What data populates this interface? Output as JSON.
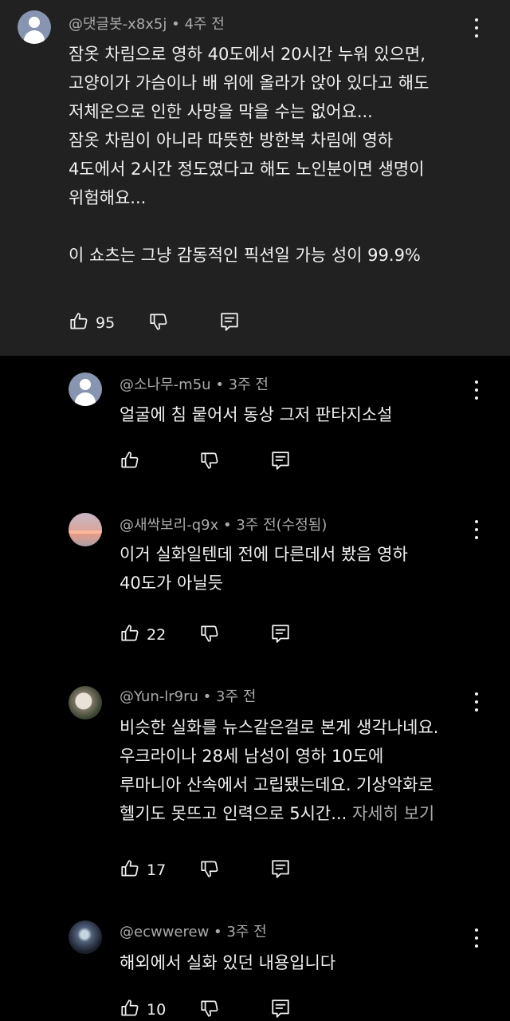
{
  "comments": [
    {
      "author": "@댓글봇-x8x5j",
      "time": "4주 전",
      "avatar": "default-avatar-icon",
      "lines": [
        "잠옷 차림으로 영하 40도에서 20시간 누워 있으면,",
        "고양이가 가슴이나 배 위에 올라가 앉아 있다고 해도",
        "저체온으로 인한 사망을 막을 수는 없어요...",
        "잠옷 차림이 아니라 따뜻한 방한복 차림에 영하",
        "4도에서 2시간 정도였다고 해도 노인분이면 생명이",
        "위험해요...",
        "",
        "이 쇼츠는 그냥 감동적인 픽션일 가능 성이 99.9%"
      ],
      "likes": "95"
    },
    {
      "author": "@소나무-m5u",
      "time": "3주 전",
      "avatar": "default-avatar-icon",
      "lines": [
        "얼굴에 침 뭍어서 동상 그저 판타지소설"
      ],
      "likes": ""
    },
    {
      "author": "@새싹보리-q9x",
      "time": "3주 전(수정됨)",
      "avatar": "sunset-photo-avatar",
      "lines": [
        "이거 실화일텐데 전에 다른데서 봤음 영하",
        "40도가 아닐듯"
      ],
      "likes": "22"
    },
    {
      "author": "@Yun-lr9ru",
      "time": "3주 전",
      "avatar": "cat-photo-avatar",
      "lines": [
        "비슷한 실화를 뉴스같은걸로 본게 생각나네요.",
        "우크라이나 28세 남성이 영하 10도에",
        "루마니아 산속에서 고립됐는데요. 기상악화로",
        "헬기도 못뜨고 인력으로 5시간..."
      ],
      "more": "자세히 보기",
      "likes": "17"
    },
    {
      "author": "@ecwwerew",
      "time": "3주 전",
      "avatar": "dark-photo-avatar",
      "lines": [
        "해외에서 실화 있던 내용입니다"
      ],
      "likes": "10"
    }
  ],
  "separator": "•",
  "colors": {
    "parent_background": "#212121",
    "page_background": "#000000",
    "secondary_text": "#aaaaaa",
    "primary_text": "#f1f1f1"
  }
}
